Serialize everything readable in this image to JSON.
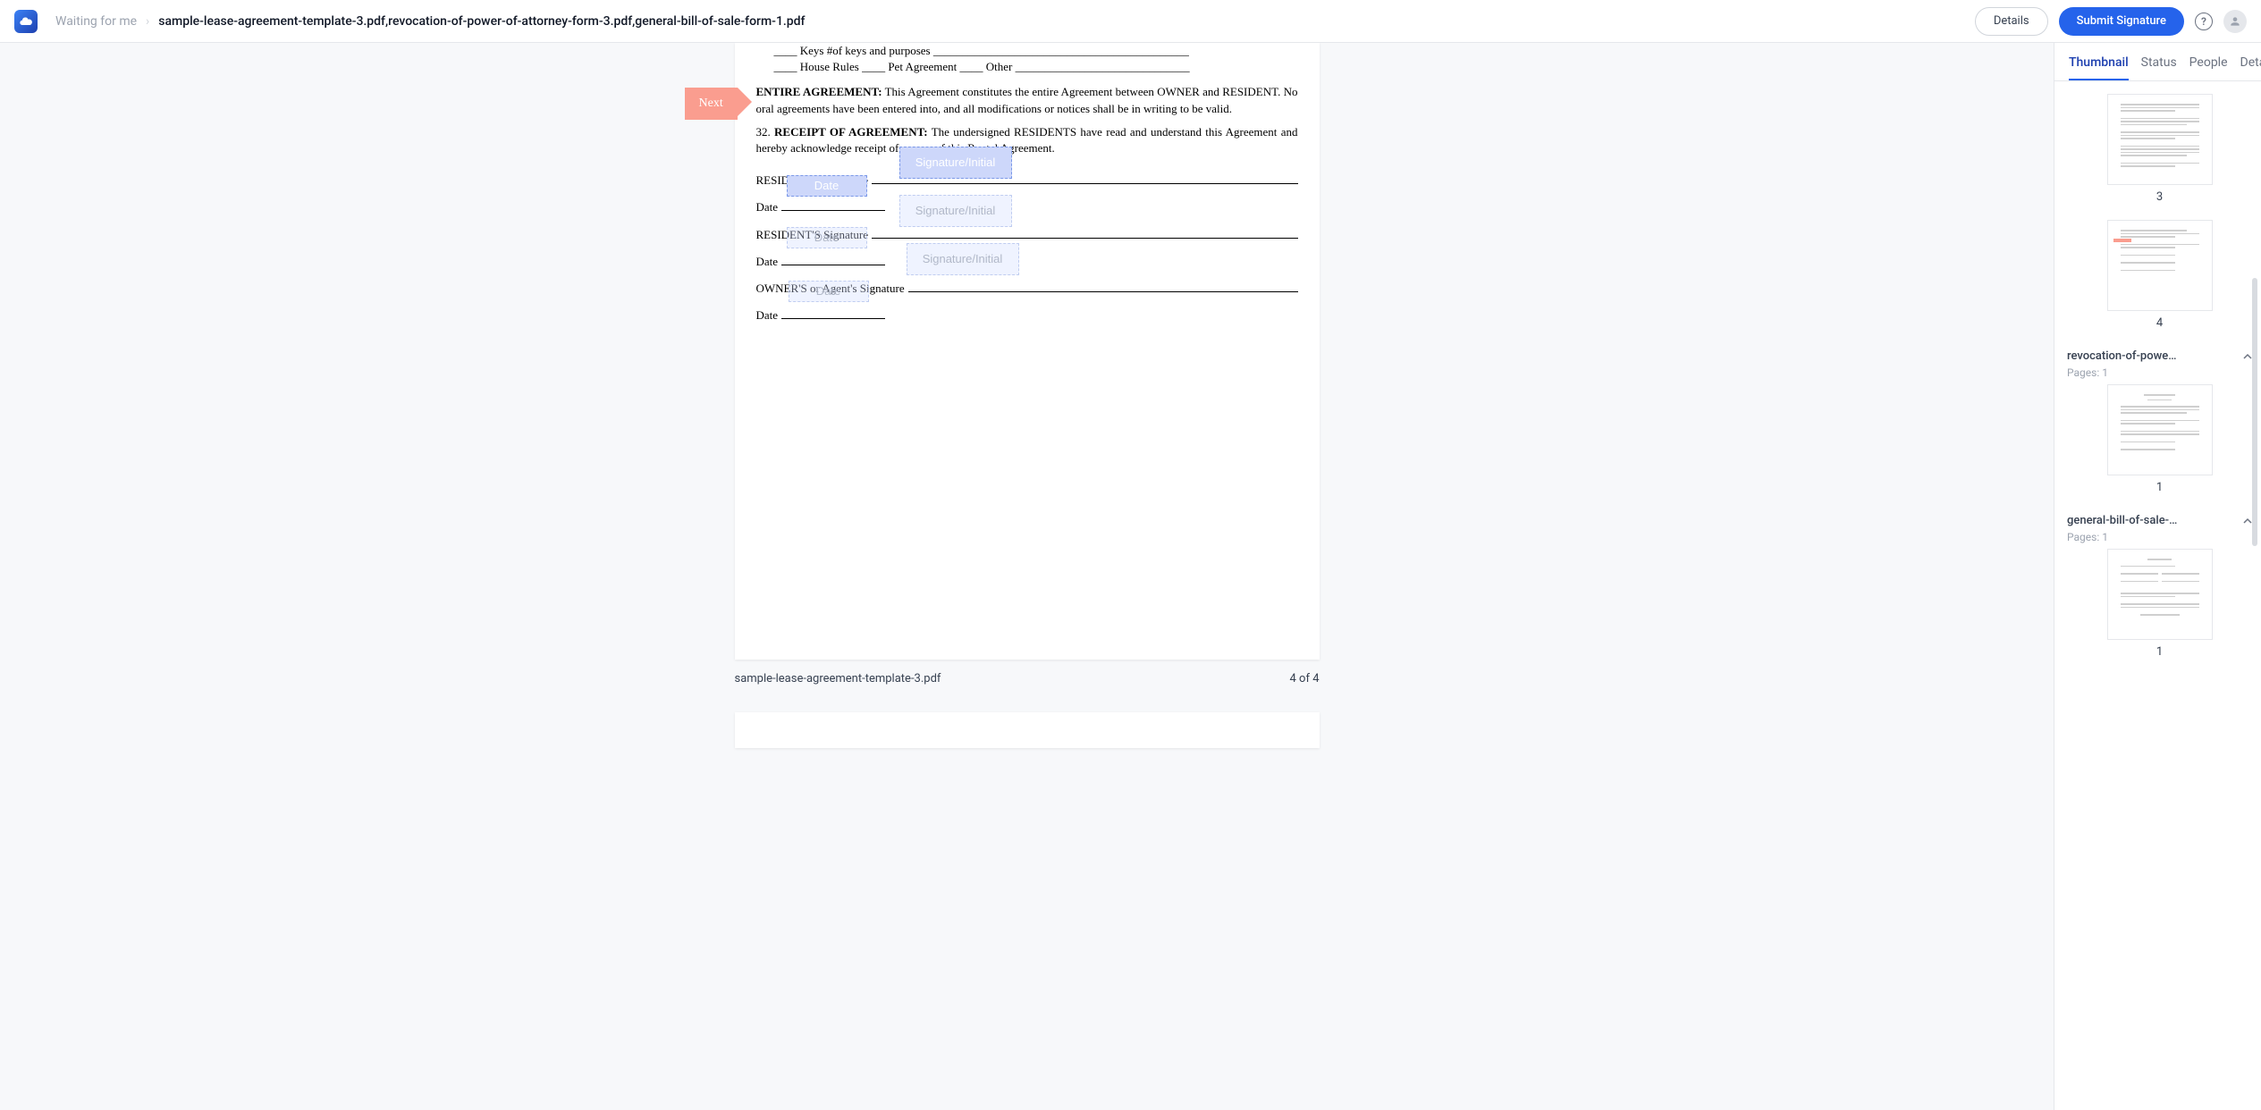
{
  "header": {
    "breadcrumb_waiting": "Waiting for me",
    "breadcrumb_title": "sample-lease-agreement-template-3.pdf,revocation-of-power-of-attorney-form-3.pdf,general-bill-of-sale-form-1.pdf",
    "details_button": "Details",
    "submit_button": "Submit Signature"
  },
  "pointer": {
    "next": "Next"
  },
  "document": {
    "line_keys": "____ Keys #of keys and purposes ____________________________________________",
    "line_house": "____ House Rules ____ Pet Agreement ____ Other ______________________________",
    "para31_bold": "ENTIRE AGREEMENT:",
    "para31_text": " This Agreement constitutes the entire Agreement between OWNER and RESIDENT. No oral agreements have been entered into, and all modifications or notices shall be in writing to be valid.",
    "para32_prefix": "32. ",
    "para32_bold": "RECEIPT OF AGREEMENT:",
    "para32_text": " The undersigned RESIDENTS have read and understand this Agreement and hereby acknowledge receipt of a copy of this Rental Agreement.",
    "resident_sig": "RESIDENT'S Signature",
    "date_label": "Date",
    "owner_sig": "OWNER'S or Agent's Signature"
  },
  "fields": {
    "signature_initial": "Signature/Initial",
    "date": "Date"
  },
  "footer": {
    "filename": "sample-lease-agreement-template-3.pdf",
    "page_info": "4 of 4"
  },
  "sidebar": {
    "tabs": {
      "thumbnail": "Thumbnail",
      "status": "Status",
      "people": "People",
      "details": "Details"
    },
    "thumbs": {
      "page3": "3",
      "page4": "4",
      "group2_title": "revocation-of-powe…",
      "group2_pages": "Pages: 1",
      "group2_thumb": "1",
      "group3_title": "general-bill-of-sale-…",
      "group3_pages": "Pages: 1",
      "group3_thumb": "1"
    }
  }
}
